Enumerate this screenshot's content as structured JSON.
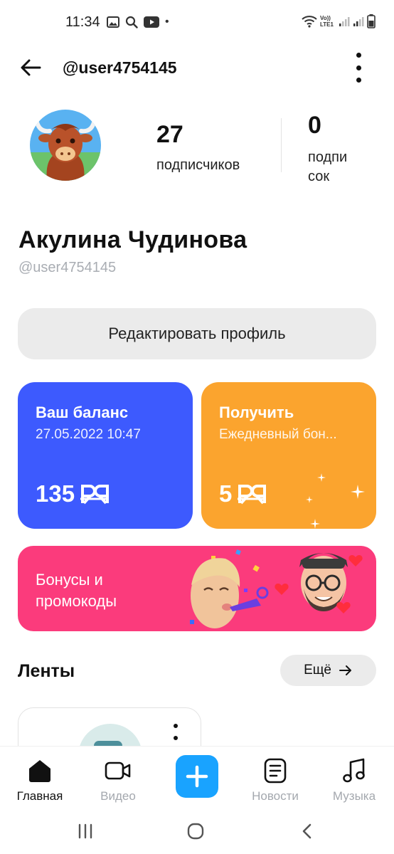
{
  "status_bar": {
    "time": "11:34",
    "dot": "•",
    "network": "Vo)) LTE1"
  },
  "header": {
    "title": "@user4754145"
  },
  "profile": {
    "followers_count": "27",
    "followers_label": "подписчиков",
    "subscriptions_count": "0",
    "subscriptions_label_line1": "подпи",
    "subscriptions_label_line2": "сок",
    "name": "Акулина Чудинова",
    "handle": "@user4754145",
    "edit_button": "Редактировать профиль"
  },
  "cards": {
    "balance": {
      "title": "Ваш баланс",
      "subtitle": "27.05.2022 10:47",
      "value": "135",
      "currency_icon": "ЯR-currency-icon",
      "color": "#3d5afe"
    },
    "bonus": {
      "title": "Получить",
      "subtitle": "Ежедневный бон...",
      "value": "5",
      "color": "#fba42e"
    },
    "promo": {
      "line1": "Бонусы и",
      "line2": "промокоды",
      "color": "#fb3b7c"
    }
  },
  "feeds": {
    "title": "Ленты",
    "more_label": "Ещё"
  },
  "bottom_nav": {
    "items": [
      {
        "label": "Главная",
        "icon": "home-icon",
        "active": true
      },
      {
        "label": "Видео",
        "icon": "video-icon",
        "active": false
      },
      {
        "label": "",
        "icon": "plus-icon",
        "active": false
      },
      {
        "label": "Новости",
        "icon": "news-icon",
        "active": false
      },
      {
        "label": "Музыка",
        "icon": "music-icon",
        "active": false
      }
    ],
    "accent": "#19a3ff"
  }
}
